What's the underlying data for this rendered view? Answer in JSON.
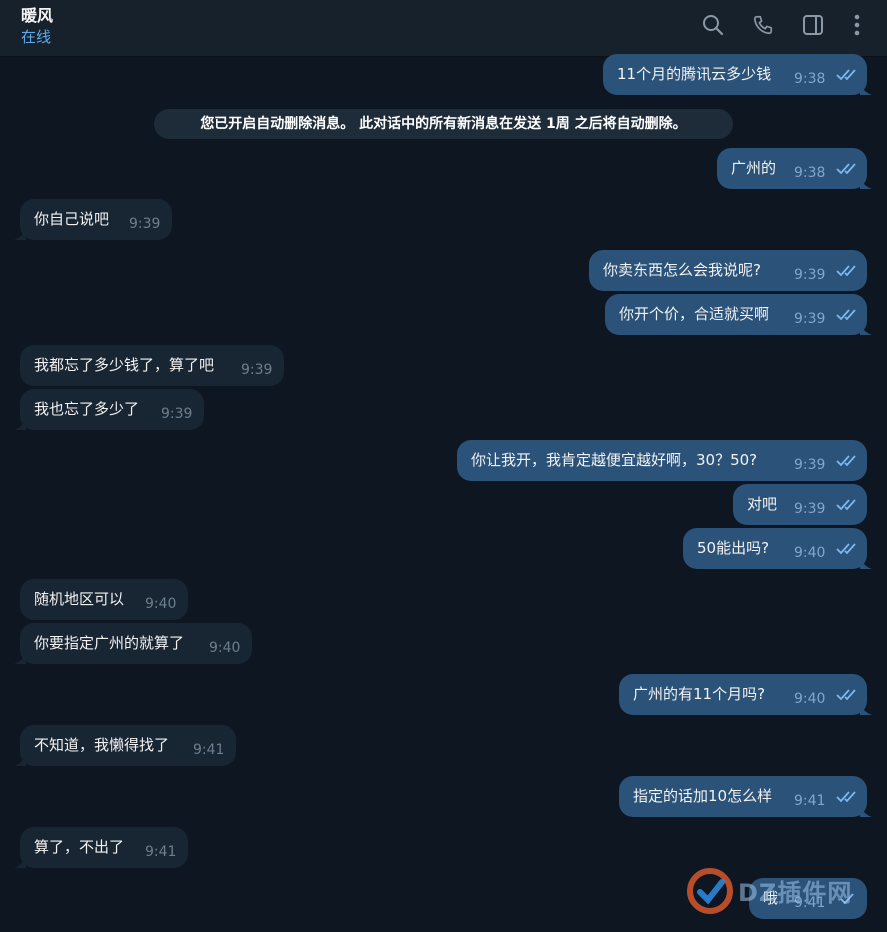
{
  "header": {
    "name": "暖风",
    "status": "在线",
    "icons": [
      "search-icon",
      "phone-icon",
      "sidebar-toggle-icon",
      "more-vertical-icon"
    ]
  },
  "service_message": "您已开启自动删除消息。 此对话中的所有新消息在发送 1周 之后将自动删除。",
  "messages": [
    {
      "text": "11个月的腾讯云多少钱",
      "time": "9:38",
      "dir": "out"
    },
    {
      "text": "广州的",
      "time": "9:38",
      "dir": "out"
    },
    {
      "text": "你自己说吧",
      "time": "9:39",
      "dir": "in"
    },
    {
      "text": "你卖东西怎么会我说呢?",
      "time": "9:39",
      "dir": "out"
    },
    {
      "text": "你开个价，合适就买啊",
      "time": "9:39",
      "dir": "out"
    },
    {
      "text": "我都忘了多少钱了，算了吧",
      "time": "9:39",
      "dir": "in"
    },
    {
      "text": "我也忘了多少了",
      "time": "9:39",
      "dir": "in"
    },
    {
      "text": "你让我开，我肯定越便宜越好啊，30？50?",
      "time": "9:39",
      "dir": "out"
    },
    {
      "text": "对吧",
      "time": "9:39",
      "dir": "out"
    },
    {
      "text": "50能出吗?",
      "time": "9:40",
      "dir": "out"
    },
    {
      "text": "随机地区可以",
      "time": "9:40",
      "dir": "in"
    },
    {
      "text": "你要指定广州的就算了",
      "time": "9:40",
      "dir": "in"
    },
    {
      "text": "广州的有11个月吗?",
      "time": "9:40",
      "dir": "out"
    },
    {
      "text": "不知道，我懒得找了",
      "time": "9:41",
      "dir": "in"
    },
    {
      "text": "指定的话加10怎么样",
      "time": "9:41",
      "dir": "out"
    },
    {
      "text": "算了，不出了",
      "time": "9:41",
      "dir": "in"
    },
    {
      "text": "哦",
      "time": "9:41",
      "dir": "out"
    }
  ],
  "watermark": {
    "text": "DZ插件网"
  },
  "colors": {
    "background": "#0e1621",
    "header": "#17212b",
    "incoming_bubble": "#182533",
    "outgoing_bubble": "#2b5278",
    "status_accent": "#5eaaeb",
    "read_ticks": "#7db8f0"
  }
}
